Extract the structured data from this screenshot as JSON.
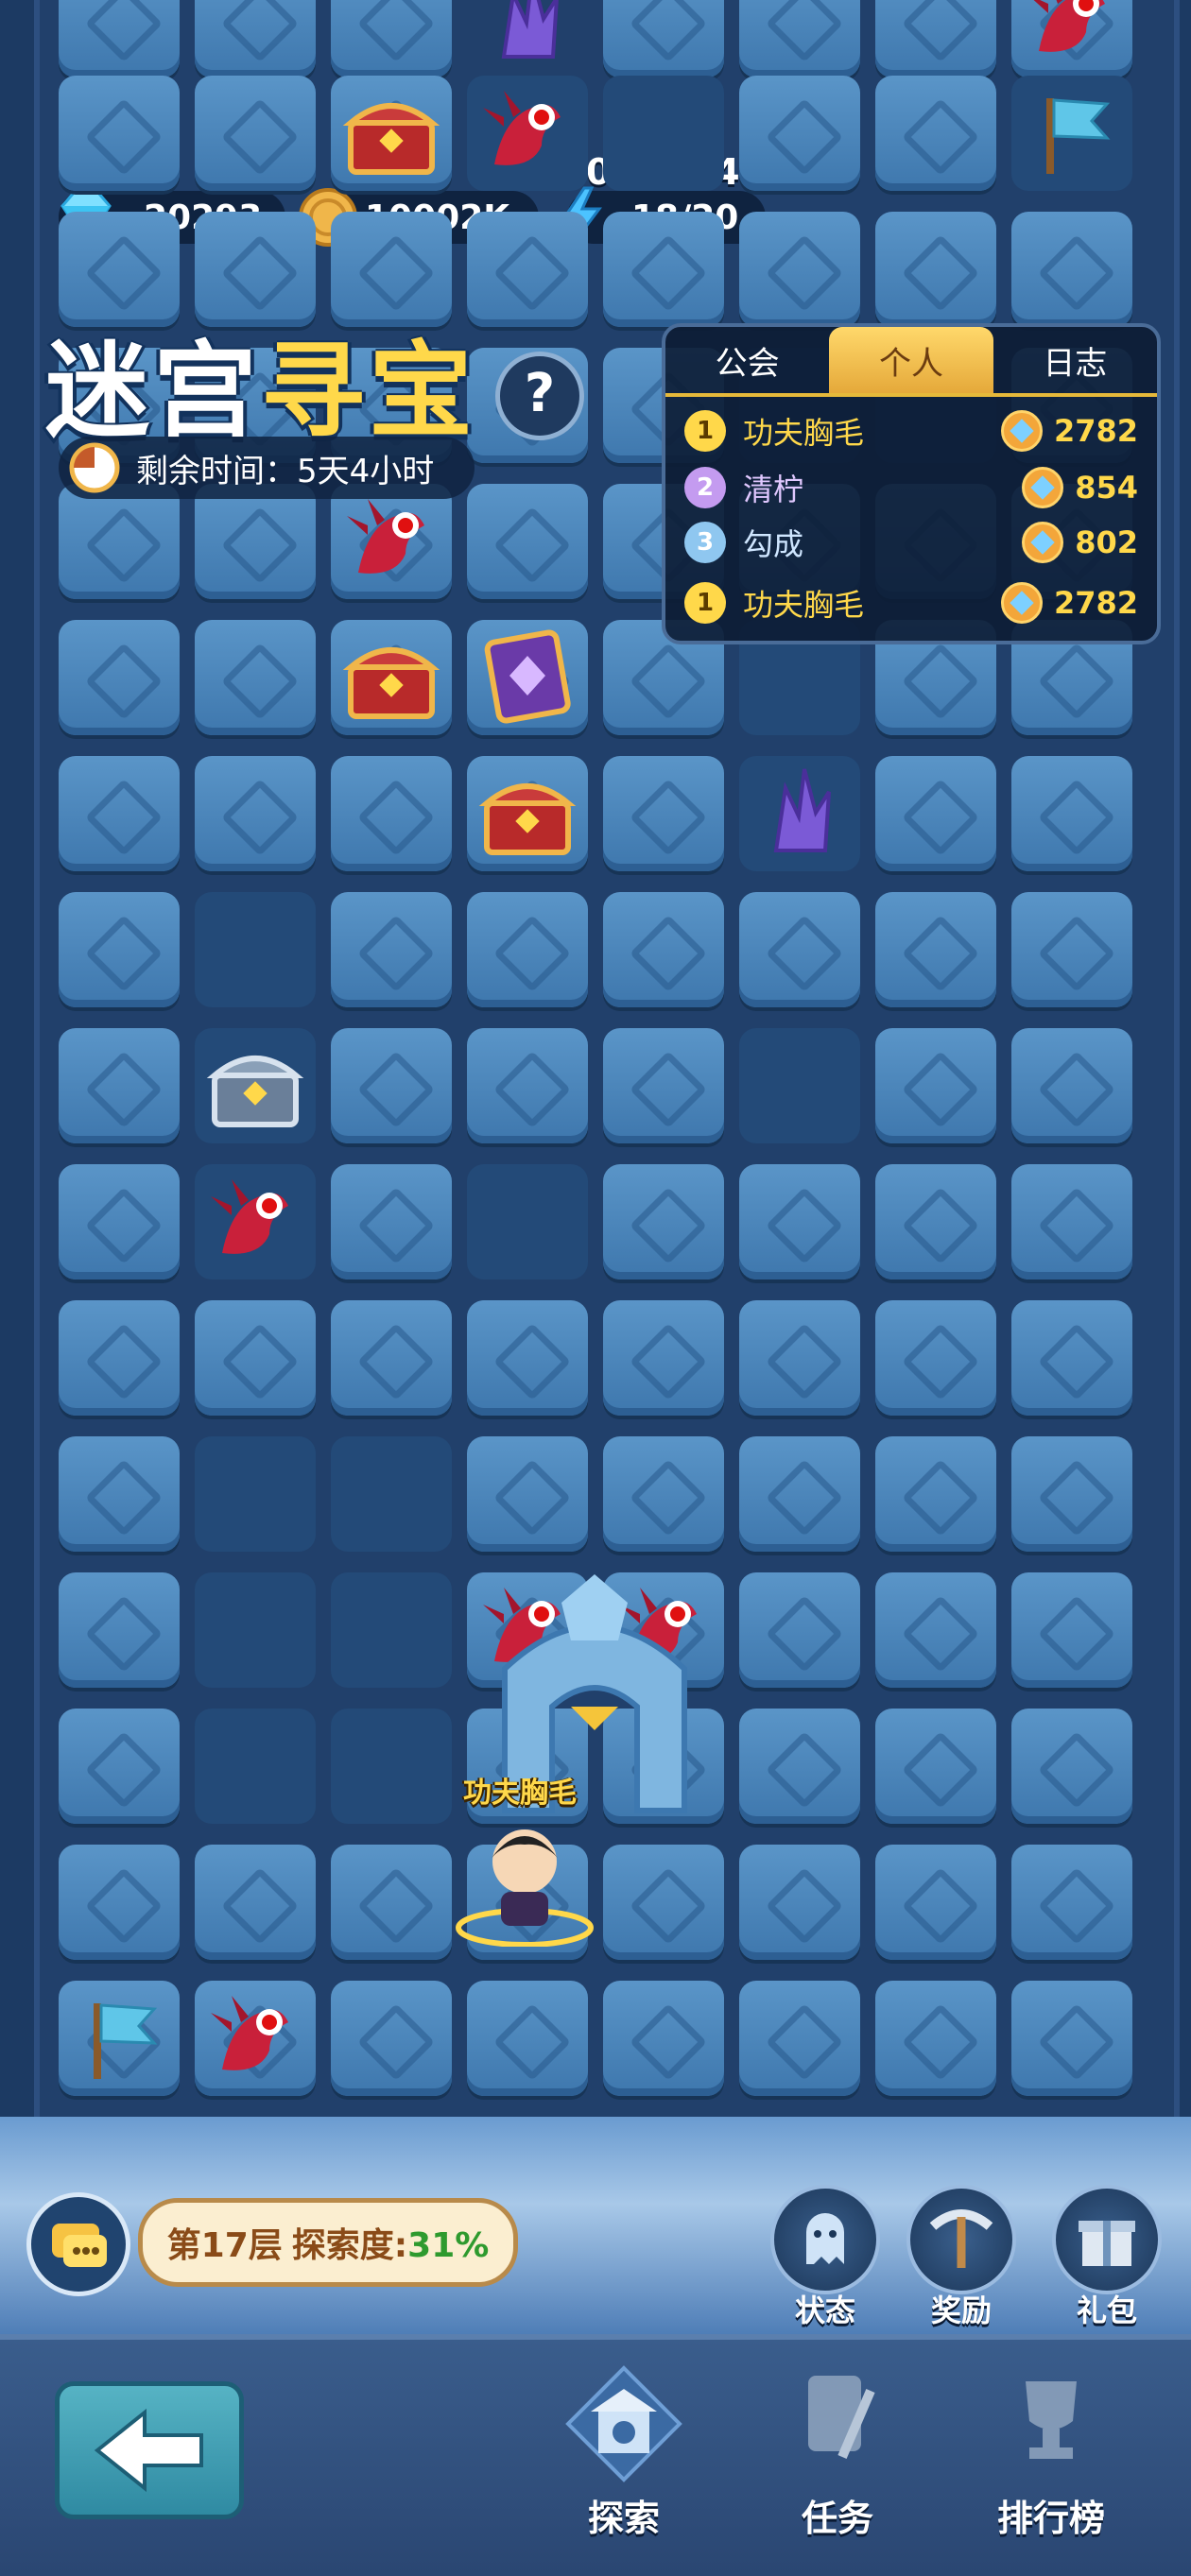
{
  "hud": {
    "gems": "20293",
    "coins": "10002K",
    "timer": "00:46:49",
    "energy": "18/20"
  },
  "event": {
    "title_part1": "迷宫",
    "title_part2": "寻宝",
    "remaining_label": "剩余时间：5天4小时"
  },
  "ranking": {
    "tabs": [
      "公会",
      "个人",
      "日志"
    ],
    "active_tab": "个人",
    "rows": [
      {
        "rank": "1",
        "name": "功夫胸毛",
        "score": "2782"
      },
      {
        "rank": "2",
        "name": "清柠",
        "score": "854"
      },
      {
        "rank": "3",
        "name": "勾成",
        "score": "802"
      }
    ],
    "self": {
      "rank": "1",
      "name": "功夫胸毛",
      "score": "2782"
    }
  },
  "player": {
    "name": "功夫胸毛"
  },
  "floor": {
    "level_label": "第17层",
    "explore_label": "探索度:",
    "explore_pct": "31%"
  },
  "side_buttons": {
    "status": "状态",
    "reward": "奖励",
    "gift": "礼包"
  },
  "nav": {
    "explore": "探索",
    "tasks": "任务",
    "leaderboard": "排行榜"
  },
  "colors": {
    "accent": "#ffd84a",
    "tile": "#4a86bd",
    "background": "#1c3a63"
  },
  "icons": [
    "diamond-icon",
    "coin-icon",
    "lightning-icon",
    "help-icon",
    "clock-icon",
    "chat-icon",
    "ghost-icon",
    "pickaxe-icon",
    "gift-icon",
    "back-arrow-icon",
    "temple-icon",
    "scroll-icon",
    "trophy-icon"
  ]
}
